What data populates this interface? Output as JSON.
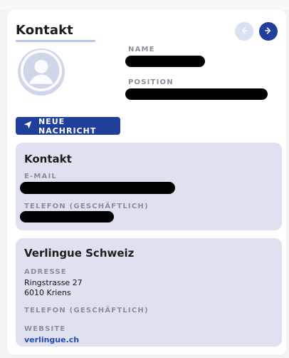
{
  "header": {
    "title": "Kontakt",
    "nav": {
      "prev_icon": "arrow-left-icon",
      "next_icon": "arrow-right-icon"
    }
  },
  "contact": {
    "name_label": "NAME",
    "position_label": "POSITION"
  },
  "actions": {
    "new_message_label": "NEUE NACHRICHT",
    "new_message_icon": "send-icon"
  },
  "kontakt_card": {
    "title": "Kontakt",
    "email_label": "E-MAIL",
    "phone_label": "TELEFON (GESCHÄFTLICH)"
  },
  "company_card": {
    "title": "Verlingue Schweiz",
    "address_label": "ADRESSE",
    "address_line1": "Ringstrasse 27",
    "address_line2": "6010 Kriens",
    "phone_label": "TELEFON (GESCHÄFTLICH)",
    "website_label": "WEBSITE",
    "website": "verlingue.ch"
  },
  "colors": {
    "accent": "#1f3f9a",
    "card_background": "#dfe1f1",
    "muted_label": "#8a8f9b",
    "redaction": "#000000"
  }
}
